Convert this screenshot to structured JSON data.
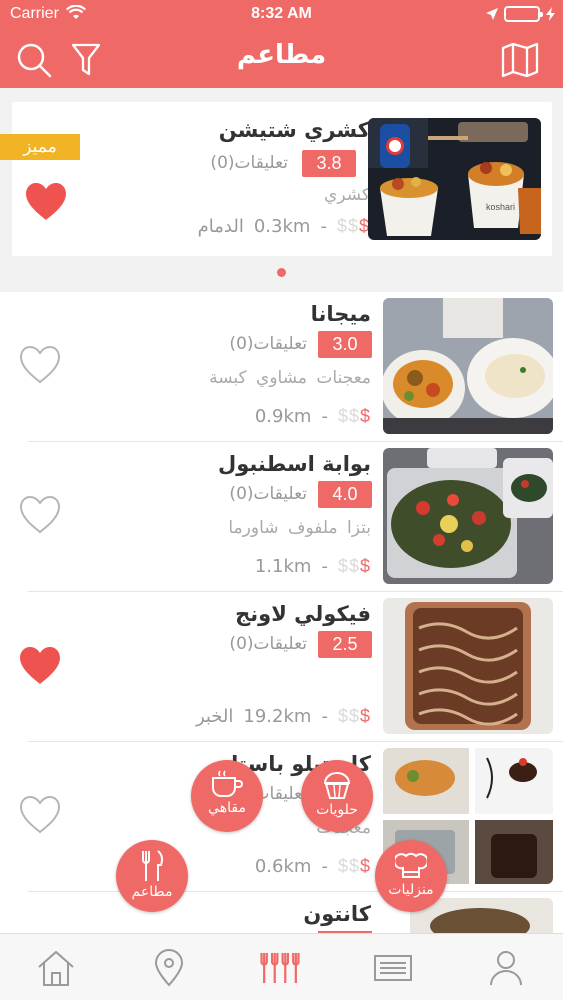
{
  "status": {
    "carrier": "Carrier",
    "time": "8:32 AM"
  },
  "nav": {
    "title": "مطاعم",
    "search_icon": "search-icon",
    "filter_icon": "filter-icon",
    "map_icon": "map-icon"
  },
  "featured": {
    "badge": "مميز",
    "name": "كشري شتيشن",
    "rating": "3.8",
    "reviews": "تعليقات(0)",
    "cuisine": "كشري",
    "price": "$$$",
    "price_filled": "$",
    "price_empty": "$$",
    "distance": "0.3km",
    "separator": "-",
    "city": "الدمام",
    "favorited": true
  },
  "restaurants": [
    {
      "name": "ميجانا",
      "rating": "3.0",
      "reviews": "تعليقات(0)",
      "cuisine": "معجنات مشاوي كبسة",
      "price_filled": "$",
      "price_empty": "$$",
      "distance": "0.9km",
      "separator": "-",
      "city": "",
      "favorited": false
    },
    {
      "name": "بوابة اسطنبول",
      "rating": "4.0",
      "reviews": "تعليقات(0)",
      "cuisine": "بتزا ملفوف شاورما",
      "price_filled": "$",
      "price_empty": "$$",
      "distance": "1.1km",
      "separator": "-",
      "city": "",
      "favorited": false
    },
    {
      "name": "فيكولي لاونج",
      "rating": "2.5",
      "reviews": "تعليقات(0)",
      "cuisine": "",
      "price_filled": "$",
      "price_empty": "$$",
      "distance": "19.2km",
      "separator": "-",
      "city": "الخبر",
      "favorited": true
    },
    {
      "name": "كاستيلو باستا",
      "rating": "",
      "reviews": "تعليقات",
      "cuisine": "معجنات",
      "price_filled": "$",
      "price_empty": "$$",
      "distance": "0.6km",
      "separator": "-",
      "city": "",
      "favorited": false
    },
    {
      "name": "كانتون",
      "rating": "",
      "reviews": "",
      "cuisine": "",
      "price_filled": "",
      "price_empty": "",
      "distance": "",
      "separator": "",
      "city": "",
      "favorited": false
    }
  ],
  "fab_menu": {
    "cafes": "مقاهي",
    "sweets": "حلويات",
    "restaurants": "مطاعم",
    "homemade": "منزليات"
  },
  "tabs": [
    {
      "icon": "home-icon"
    },
    {
      "icon": "location-pin-icon"
    },
    {
      "icon": "restaurants-forks-icon",
      "active": true
    },
    {
      "icon": "list-icon"
    },
    {
      "icon": "profile-icon"
    }
  ],
  "colors": {
    "accent": "#ef6a66",
    "badge": "#f0b426",
    "background": "#f2f2f2"
  }
}
